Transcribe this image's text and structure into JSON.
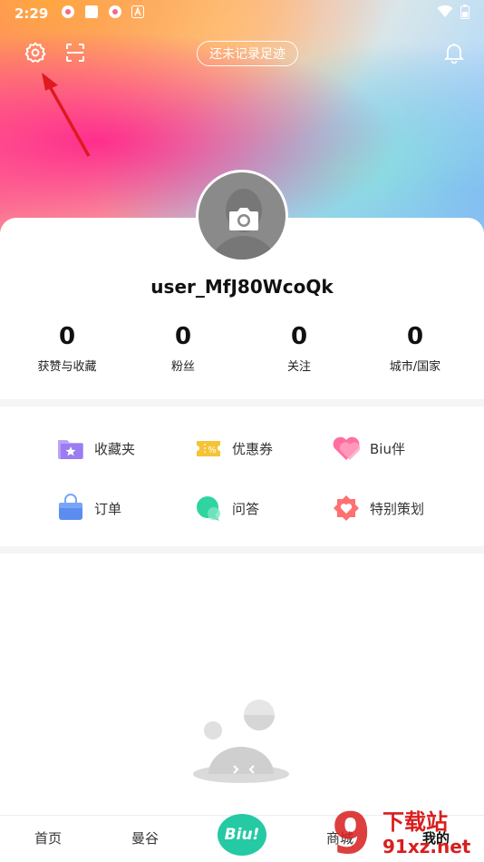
{
  "status_bar": {
    "time": "2:29"
  },
  "header": {
    "footprint_button": "还未记录足迹"
  },
  "profile": {
    "username": "user_MfJ80WcoQk"
  },
  "stats": [
    {
      "value": "0",
      "label": "获赞与收藏"
    },
    {
      "value": "0",
      "label": "粉丝"
    },
    {
      "value": "0",
      "label": "关注"
    },
    {
      "value": "0",
      "label": "城市/国家"
    }
  ],
  "menu": [
    {
      "label": "收藏夹",
      "icon": "folder-star-icon",
      "color": "#9b7cf2"
    },
    {
      "label": "优惠券",
      "icon": "coupon-icon",
      "color": "#f5c436"
    },
    {
      "label": "Biu伴",
      "icon": "heart-icon",
      "color": "#ff6fa0"
    },
    {
      "label": "订单",
      "icon": "bag-icon",
      "color": "#5b8cf0"
    },
    {
      "label": "问答",
      "icon": "chat-bubble-icon",
      "color": "#2fd4a0"
    },
    {
      "label": "特别策划",
      "icon": "badge-heart-icon",
      "color": "#ff7070"
    }
  ],
  "tabbar": {
    "tabs": [
      {
        "label": "首页"
      },
      {
        "label": "曼谷"
      },
      {
        "label": "Biu!"
      },
      {
        "label": "商城"
      },
      {
        "label": "我的"
      }
    ]
  },
  "watermark": {
    "line1": "下载站",
    "line2": "91xz.net"
  }
}
